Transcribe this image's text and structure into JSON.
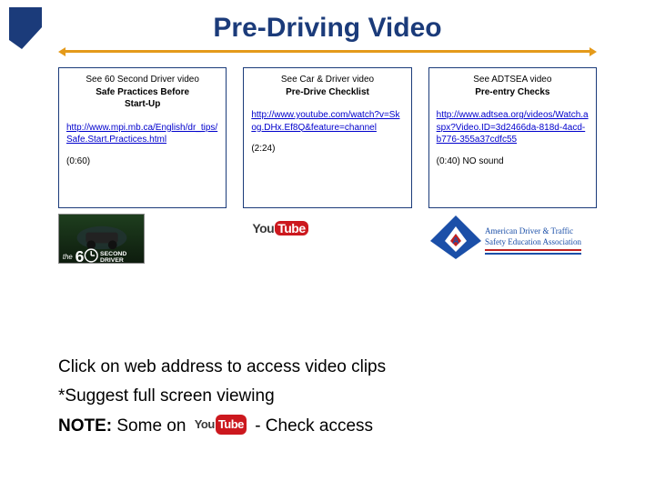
{
  "title": "Pre-Driving Video",
  "cards": [
    {
      "line1": "See 60 Second Driver video",
      "line2": "Safe Practices Before",
      "line3": "Start-Up",
      "link": "http://www.mpi.mb.ca/English/dr_tips/Safe.Start.Practices.html",
      "duration": "(0:60)",
      "dur_note": ""
    },
    {
      "line1": "See Car & Driver video",
      "line2": "Pre-Drive Checklist",
      "line3": "",
      "link": "http://www.youtube.com/watch?v=Skog.DHx.Ef8Q&feature=channel",
      "duration": "(2:24)",
      "dur_note": ""
    },
    {
      "line1": "See ADTSEA video",
      "line2": "Pre-entry Checks",
      "line3": "",
      "link": "http://www.adtsea.org/videos/Watch.aspx?Video.ID=3d2466da-818d-4acd-b776-355a37cdfc55",
      "duration": "(0:40)",
      "dur_note": " NO sound"
    }
  ],
  "bottom": {
    "line1": "Click on web address to access video clips",
    "line2": "*Suggest full screen viewing",
    "note_label": "NOTE:",
    "note_before": " Some on ",
    "note_after": " - Check access"
  },
  "yt": {
    "you": "You",
    "tube": "Tube"
  },
  "adtsea_text": {
    "t1": "American Driver & Traffic",
    "t2": "Safety Education Association"
  }
}
